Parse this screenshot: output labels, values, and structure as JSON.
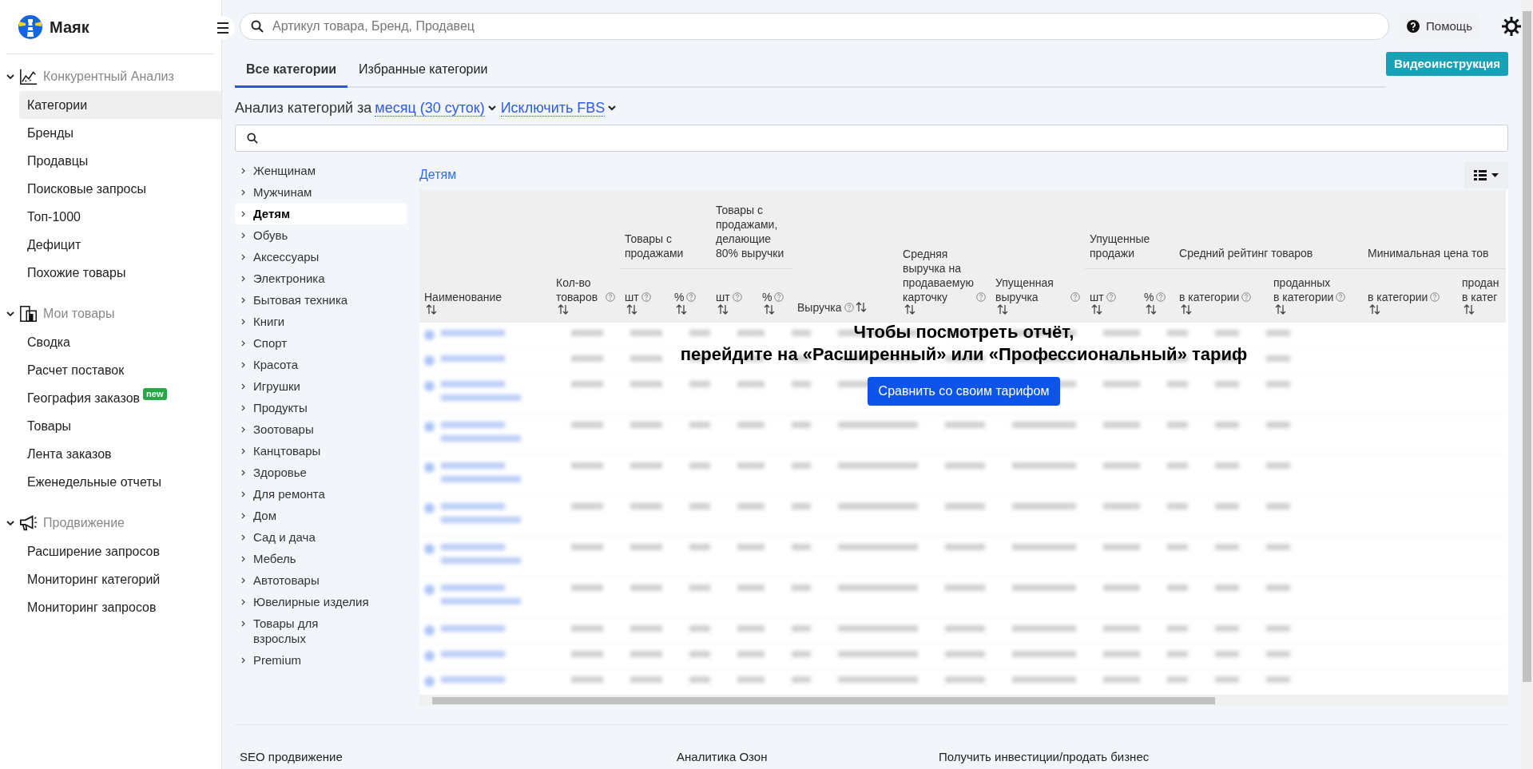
{
  "brand": {
    "name": "Маяк"
  },
  "sidebar": {
    "sections": [
      {
        "label": "Конкурентный Анализ",
        "expanded": true,
        "items": [
          {
            "label": "Категории",
            "selected": true
          },
          {
            "label": "Бренды",
            "selected": false
          },
          {
            "label": "Продавцы",
            "selected": false
          },
          {
            "label": "Поисковые запросы",
            "selected": false
          },
          {
            "label": "Топ-1000",
            "selected": false
          },
          {
            "label": "Дефицит",
            "selected": false
          },
          {
            "label": "Похожие товары",
            "selected": false
          }
        ]
      },
      {
        "label": "Мои товары",
        "expanded": true,
        "items": [
          {
            "label": "Сводка",
            "selected": false
          },
          {
            "label": "Расчет поставок",
            "selected": false
          },
          {
            "label": "География заказов",
            "badge": "new",
            "selected": false
          },
          {
            "label": "Товары",
            "selected": false
          },
          {
            "label": "Лента заказов",
            "selected": false
          },
          {
            "label": "Еженедельные отчеты",
            "selected": false
          }
        ]
      },
      {
        "label": "Продвижение",
        "expanded": true,
        "items": [
          {
            "label": "Расширение запросов",
            "selected": false
          },
          {
            "label": "Мониторинг категорий",
            "selected": false
          },
          {
            "label": "Мониторинг запросов",
            "selected": false
          }
        ]
      }
    ]
  },
  "top_bar": {
    "search": {
      "placeholder": "Артикул товара, Бренд, Продавец"
    },
    "help": "Помощь"
  },
  "tabs": [
    {
      "label": "Все категории",
      "selected": true
    },
    {
      "label": "Избранные категории",
      "selected": false
    }
  ],
  "video_button": "Видеоинструкция",
  "period": {
    "prefix": "Анализ категорий за",
    "period": "месяц (30 суток)",
    "filter": "Исключить FBS"
  },
  "categories": [
    {
      "label": "Женщинам",
      "selected": false
    },
    {
      "label": "Мужчинам",
      "selected": false
    },
    {
      "label": "Детям",
      "selected": true
    },
    {
      "label": "Обувь",
      "selected": false
    },
    {
      "label": "Аксессуары",
      "selected": false
    },
    {
      "label": "Электроника",
      "selected": false
    },
    {
      "label": "Бытовая техника",
      "selected": false
    },
    {
      "label": "Книги",
      "selected": false
    },
    {
      "label": "Спорт",
      "selected": false
    },
    {
      "label": "Красота",
      "selected": false
    },
    {
      "label": "Игрушки",
      "selected": false
    },
    {
      "label": "Продукты",
      "selected": false
    },
    {
      "label": "Зоотовары",
      "selected": false
    },
    {
      "label": "Канцтовары",
      "selected": false
    },
    {
      "label": "Здоровье",
      "selected": false
    },
    {
      "label": "Для ремонта",
      "selected": false
    },
    {
      "label": "Дом",
      "selected": false
    },
    {
      "label": "Сад и дача",
      "selected": false
    },
    {
      "label": "Мебель",
      "selected": false
    },
    {
      "label": "Автотовары",
      "selected": false
    },
    {
      "label": "Ювелирные изделия",
      "selected": false
    },
    {
      "label": "Товары для взрослых",
      "selected": false
    },
    {
      "label": "Premium",
      "selected": false
    }
  ],
  "breadcrumb": "Детям",
  "table": {
    "columns": [
      {
        "label": "Наименование",
        "help": false
      },
      {
        "label": "Кол-во товаров",
        "help": true
      },
      {
        "label": "Товары с продажами",
        "sub": [
          {
            "label": "шт",
            "help": true
          },
          {
            "label": "%",
            "help": true
          }
        ]
      },
      {
        "label": "Товары с продажами, делающие 80% выручки",
        "sub": [
          {
            "label": "шт",
            "help": true
          },
          {
            "label": "%",
            "help": true
          }
        ]
      },
      {
        "label": "Выручка",
        "help": true
      },
      {
        "label": "Средняя выручка на продаваемую карточку",
        "help": true
      },
      {
        "label": "Упущенная выручка",
        "help": true
      },
      {
        "label": "Упущенные продажи",
        "sub": [
          {
            "label": "шт",
            "help": true
          },
          {
            "label": "%",
            "help": true
          }
        ]
      },
      {
        "label": "Средний рейтинг товаров",
        "sub": [
          {
            "label": "в категории",
            "help": true
          },
          {
            "label": "проданных в категории",
            "help": true
          }
        ]
      },
      {
        "label": "Минимальная цена тов",
        "sub": [
          {
            "label": "в категории",
            "help": true
          },
          {
            "label": "продан в катег",
            "help": false
          }
        ]
      }
    ],
    "blurred_rows": [
      {
        "two_line": false
      },
      {
        "two_line": false
      },
      {
        "two_line": true
      },
      {
        "two_line": true
      },
      {
        "two_line": true
      },
      {
        "two_line": true
      },
      {
        "two_line": true
      },
      {
        "two_line": true
      },
      {
        "two_line": false
      },
      {
        "two_line": false
      },
      {
        "two_line": false
      }
    ]
  },
  "overlay": {
    "title": "Чтобы посмотреть отчёт,",
    "subtitle": "перейдите на «Расширенный» или «Профессиональный» тариф",
    "button": "Сравнить со своим тарифом"
  },
  "footer": [
    "SEO продвижение",
    "Аналитика Озон",
    "Получить инвестиции/продать бизнес"
  ]
}
